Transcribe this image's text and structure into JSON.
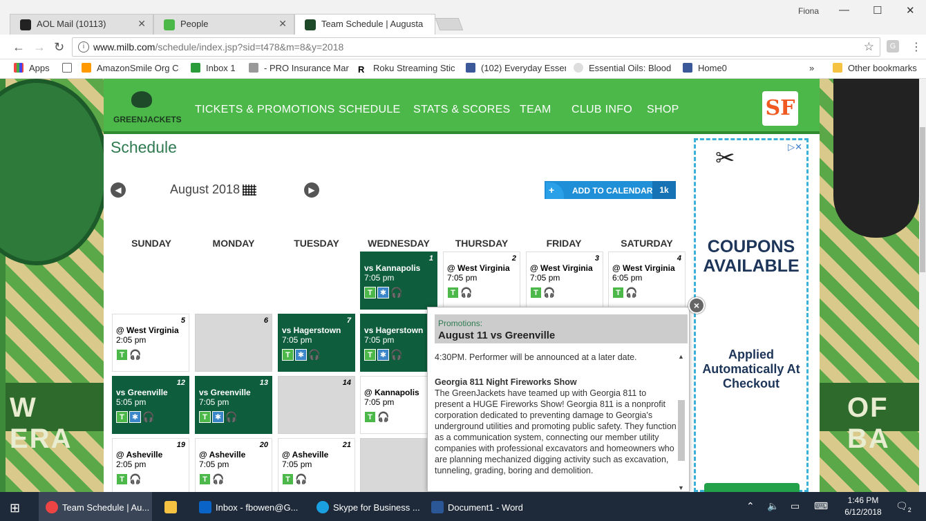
{
  "browser": {
    "profile": "Fiona",
    "tabs": [
      {
        "label": "AOL Mail (10113)"
      },
      {
        "label": "People"
      },
      {
        "label": "Team Schedule | Augusta"
      }
    ],
    "url_host": "www.milb.com",
    "url_path": "/schedule/index.jsp?sid=t478&m=8&y=2018",
    "bookmarks": [
      {
        "label": "Apps"
      },
      {
        "label": "AmazonSmile Org C"
      },
      {
        "label": "Inbox 1"
      },
      {
        "label": "- PRO Insurance Mar"
      },
      {
        "label": "Roku Streaming Stic"
      },
      {
        "label": "(102) Everyday Essen"
      },
      {
        "label": "Essential Oils: Blood"
      },
      {
        "label": "Home0"
      }
    ],
    "bookmarks_overflow": "»",
    "other_bookmarks": "Other bookmarks"
  },
  "site": {
    "logo_text": "GREENJACKETS",
    "nav": [
      "TICKETS & PROMOTIONS",
      "SCHEDULE",
      "STATS & SCORES",
      "TEAM",
      "CLUB INFO",
      "SHOP"
    ],
    "affiliate_logo": "SF"
  },
  "schedule": {
    "title": "Schedule",
    "month": "August 2018",
    "add_to_calendar": "ADD TO CALENDAR",
    "add_count": "1k",
    "days": [
      "SUNDAY",
      "MONDAY",
      "TUESDAY",
      "WEDNESDAY",
      "THURSDAY",
      "FRIDAY",
      "SATURDAY"
    ],
    "games": [
      {
        "day": "1",
        "opp": "vs Kannapolis",
        "time": "7:05 pm",
        "home": true,
        "promo": true
      },
      {
        "day": "2",
        "opp": "@ West Virginia",
        "time": "7:05 pm",
        "home": false,
        "promo": false
      },
      {
        "day": "3",
        "opp": "@ West Virginia",
        "time": "7:05 pm",
        "home": false,
        "promo": false
      },
      {
        "day": "4",
        "opp": "@ West Virginia",
        "time": "6:05 pm",
        "home": false,
        "promo": false
      },
      {
        "day": "5",
        "opp": "@ West Virginia",
        "time": "2:05 pm",
        "home": false,
        "promo": false
      },
      {
        "day": "6",
        "opp": "",
        "time": "",
        "empty": true
      },
      {
        "day": "7",
        "opp": "vs Hagerstown",
        "time": "7:05 pm",
        "home": true,
        "promo": true
      },
      {
        "day": "",
        "opp": "vs Hagerstown",
        "time": "7:05 pm",
        "home": true,
        "promo": true
      },
      {
        "day": "12",
        "opp": "vs Greenville",
        "time": "5:05 pm",
        "home": true,
        "promo": true
      },
      {
        "day": "13",
        "opp": "vs Greenville",
        "time": "7:05 pm",
        "home": true,
        "promo": true
      },
      {
        "day": "14",
        "opp": "",
        "time": "",
        "empty": true
      },
      {
        "day": "",
        "opp": "@ Kannapolis",
        "time": "7:05 pm",
        "home": false,
        "promo": false
      },
      {
        "day": "19",
        "opp": "@ Asheville",
        "time": "2:05 pm",
        "home": false,
        "promo": false
      },
      {
        "day": "20",
        "opp": "@ Asheville",
        "time": "7:05 pm",
        "home": false,
        "promo": false
      },
      {
        "day": "21",
        "opp": "@ Asheville",
        "time": "7:05 pm",
        "home": false,
        "promo": false
      },
      {
        "day": "",
        "opp": "",
        "time": "",
        "empty": true
      }
    ],
    "ticket_icon": "T"
  },
  "popup": {
    "label": "Promotions:",
    "title": "August 11 vs Greenville",
    "intro": "4:30PM. Performer will be announced at a later date.",
    "event_title": "Georgia 811 Night Fireworks Show",
    "event_text": "The GreenJackets have teamed up with Georgia 811 to present a HUGE Fireworks Show! Georgia 811 is a nonprofit corporation dedicated to preventing damage to Georgia's underground utilities and promoting public safety. They function as a communication system, connecting our member utility companies with professional excavators and homeowners who are planning mechanized digging activity such as excavation, tunneling, grading, boring and demolition.",
    "close": "×"
  },
  "ad": {
    "headline": "COUPONS AVAILABLE",
    "subtext": "Applied Automatically At Checkout",
    "choices": "▷✕"
  },
  "background": {
    "left_text": "W ERA",
    "right_text": "OF BA"
  },
  "taskbar": {
    "items": [
      {
        "label": "Team Schedule | Au..."
      },
      {
        "label": "Inbox - fbowen@G..."
      },
      {
        "label": "Skype for Business ..."
      },
      {
        "label": "Document1 - Word"
      }
    ],
    "time": "1:46 PM",
    "date": "6/12/2018",
    "notifications": "2"
  },
  "colors": {
    "nav_green": "#4cb849",
    "home_cell": "#0e5e3e",
    "accent_blue": "#1f8fd8"
  }
}
